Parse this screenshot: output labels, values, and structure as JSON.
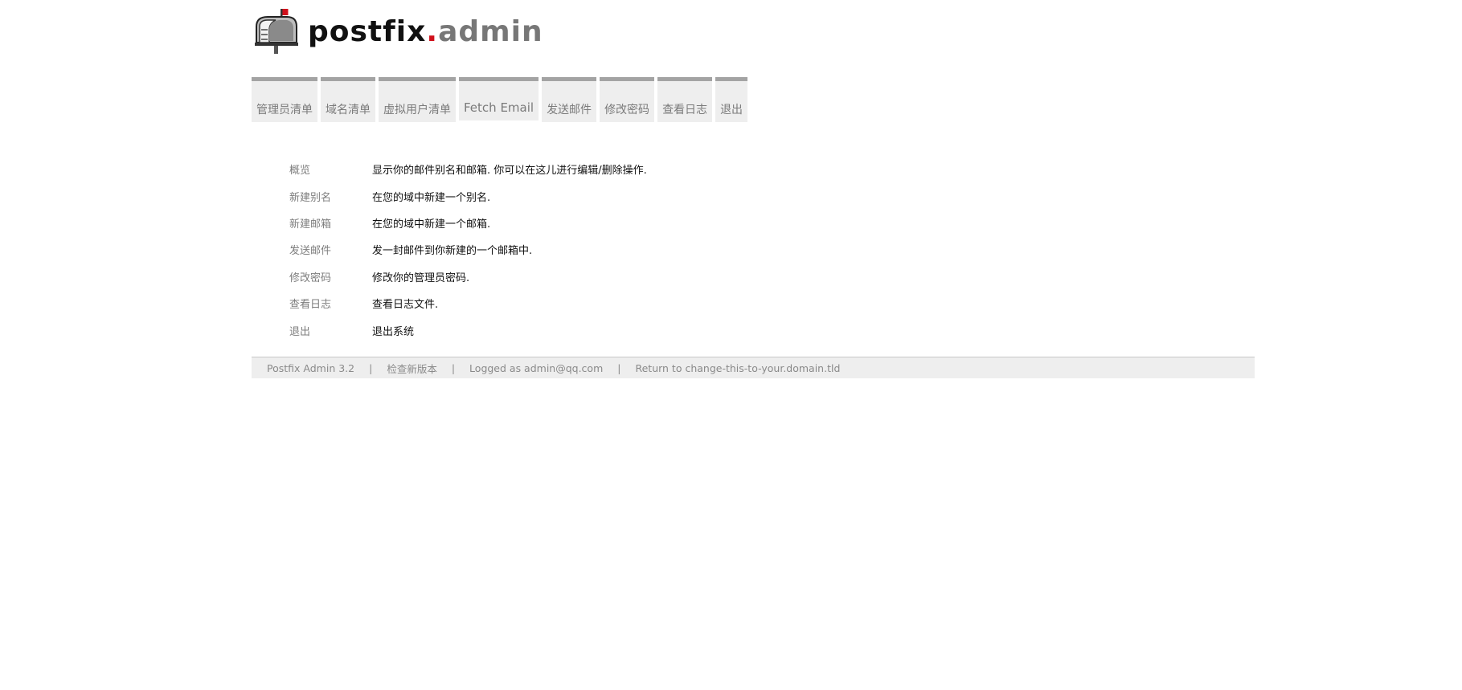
{
  "logo": {
    "word1": "postfix",
    "dot": ".",
    "word2": "admin"
  },
  "menu": [
    {
      "label": "管理员清单"
    },
    {
      "label": "域名清单"
    },
    {
      "label": "虚拟用户清单"
    },
    {
      "label": "Fetch Email"
    },
    {
      "label": "发送邮件"
    },
    {
      "label": "修改密码"
    },
    {
      "label": "查看日志"
    },
    {
      "label": "退出"
    }
  ],
  "overview": [
    {
      "link": "概览",
      "desc": "显示你的邮件别名和邮箱. 你可以在这儿进行编辑/删除操作."
    },
    {
      "link": "新建别名",
      "desc": "在您的域中新建一个别名."
    },
    {
      "link": "新建邮箱",
      "desc": "在您的域中新建一个邮箱."
    },
    {
      "link": "发送邮件",
      "desc": "发一封邮件到你新建的一个邮箱中."
    },
    {
      "link": "修改密码",
      "desc": "修改你的管理员密码."
    },
    {
      "link": "查看日志",
      "desc": "查看日志文件."
    },
    {
      "link": "退出",
      "desc": "退出系统"
    }
  ],
  "footer": {
    "version": "Postfix Admin 3.2",
    "separator": "|",
    "check_update": "检查新版本",
    "logged_as": "Logged as admin@qq.com",
    "return_link": "Return to change-this-to-your.domain.tld"
  },
  "colors": {
    "menu_bg": "#eeeeee",
    "menu_border": "#a3a3a3",
    "logo_dot": "#d0101b",
    "link_gray": "#7d7d7d",
    "footer_bg": "#eeeeee"
  },
  "icons": {
    "logo": "mailbox-icon"
  }
}
